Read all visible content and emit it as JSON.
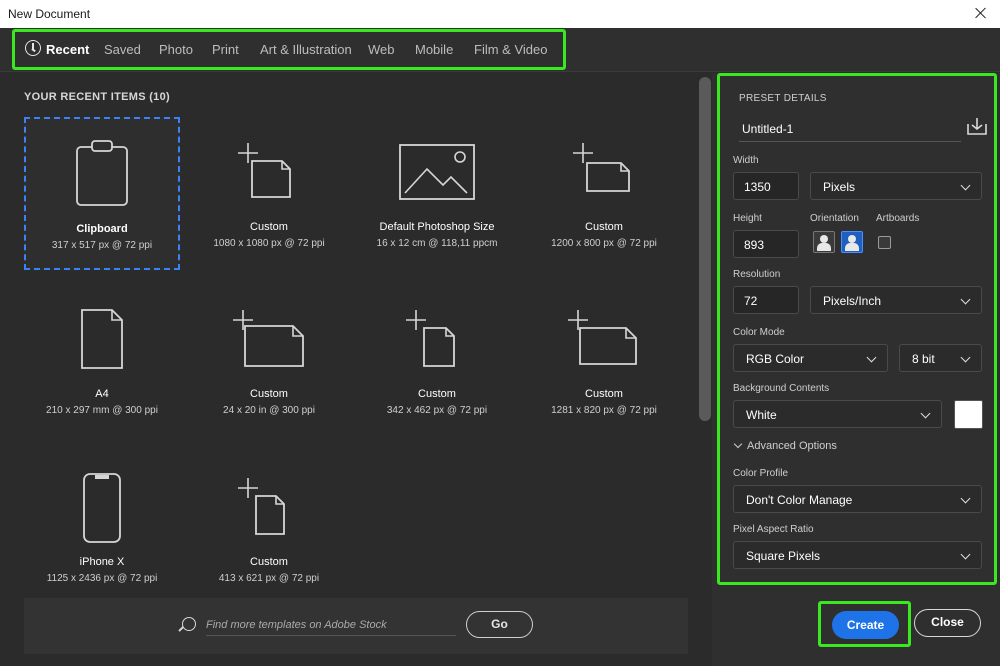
{
  "window": {
    "title": "New Document"
  },
  "tabs": [
    {
      "label": "Recent"
    },
    {
      "label": "Saved"
    },
    {
      "label": "Photo"
    },
    {
      "label": "Print"
    },
    {
      "label": "Art & Illustration"
    },
    {
      "label": "Web"
    },
    {
      "label": "Mobile"
    },
    {
      "label": "Film & Video"
    }
  ],
  "recent": {
    "heading": "YOUR RECENT ITEMS",
    "count": "(10)",
    "items": [
      {
        "name": "Clipboard",
        "dims": "317 x 517 px @ 72 ppi",
        "icon": "clipboard-icon"
      },
      {
        "name": "Custom",
        "dims": "1080 x 1080 px @ 72 ppi",
        "icon": "custom-doc-icon"
      },
      {
        "name": "Default Photoshop Size",
        "dims": "16 x 12 cm @ 118,11 ppcm",
        "icon": "image-icon"
      },
      {
        "name": "Custom",
        "dims": "1200 x 800 px @ 72 ppi",
        "icon": "custom-doc-icon"
      },
      {
        "name": "A4",
        "dims": "210 x 297 mm @ 300 ppi",
        "icon": "document-icon"
      },
      {
        "name": "Custom",
        "dims": "24 x 20 in @ 300 ppi",
        "icon": "custom-doc-icon"
      },
      {
        "name": "Custom",
        "dims": "342 x 462 px @ 72 ppi",
        "icon": "custom-doc-icon"
      },
      {
        "name": "Custom",
        "dims": "1281 x 820 px @ 72 ppi",
        "icon": "custom-doc-icon"
      },
      {
        "name": "iPhone X",
        "dims": "1125 x 2436 px @ 72 ppi",
        "icon": "phone-icon"
      },
      {
        "name": "Custom",
        "dims": "413 x 621 px @ 72 ppi",
        "icon": "custom-doc-icon"
      }
    ]
  },
  "search": {
    "placeholder": "Find more templates on Adobe Stock",
    "go_label": "Go"
  },
  "preset": {
    "heading": "PRESET DETAILS",
    "name": "Untitled-1",
    "width_label": "Width",
    "width": "1350",
    "width_unit": "Pixels",
    "height_label": "Height",
    "height": "893",
    "orientation_label": "Orientation",
    "artboards_label": "Artboards",
    "resolution_label": "Resolution",
    "resolution": "72",
    "resolution_unit": "Pixels/Inch",
    "color_mode_label": "Color Mode",
    "color_mode": "RGB Color",
    "bit_depth": "8 bit",
    "background_label": "Background Contents",
    "background": "White",
    "advanced_label": "Advanced Options",
    "color_profile_label": "Color Profile",
    "color_profile": "Don't Color Manage",
    "pixel_aspect_label": "Pixel Aspect Ratio",
    "pixel_aspect": "Square Pixels"
  },
  "actions": {
    "create_label": "Create",
    "close_label": "Close"
  },
  "colors": {
    "highlight": "#39e81e",
    "primary": "#1f73e8",
    "selection": "#3b82f6"
  }
}
